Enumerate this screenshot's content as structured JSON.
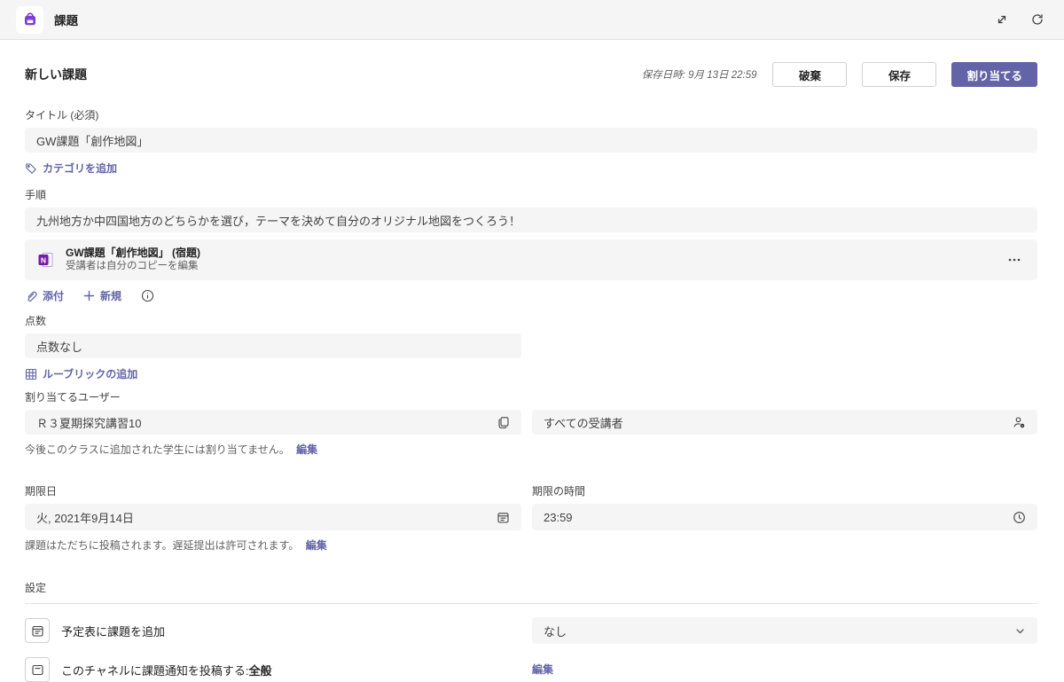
{
  "accent": "#6264a7",
  "topbar": {
    "app_title": "課題"
  },
  "header": {
    "page_title": "新しい課題",
    "saved_at": "保存日時: 9月 13日 22:59",
    "discard_label": "破棄",
    "save_label": "保存",
    "assign_label": "割り当てる"
  },
  "form": {
    "title_label": "タイトル (必須)",
    "title_value": "GW課題「創作地図」",
    "add_category_label": "カテゴリを追加",
    "instructions_label": "手順",
    "instructions_value": "九州地方か中四国地方のどちらかを選び，テーマを決めて自分のオリジナル地図をつくろう！",
    "attachment": {
      "title": "GW課題「創作地図」 (宿題)",
      "subtitle": "受講者は自分のコピーを編集"
    },
    "attach_label": "添付",
    "new_label": "新規",
    "points_label": "点数",
    "points_value": "点数なし",
    "add_rubric_label": "ルーブリックの追加",
    "assign_to_label": "割り当てるユーザー",
    "class_value": "Ｒ３夏期探究講習10",
    "students_value": "すべての受講者",
    "future_note": "今後このクラスに追加された学生には割り当てません。",
    "edit_label": "編集",
    "due_date_label": "期限日",
    "due_date_value": "火, 2021年9月14日",
    "due_time_label": "期限の時間",
    "due_time_value": "23:59",
    "post_note": "課題はただちに投稿されます。遅延提出は許可されます。"
  },
  "settings": {
    "heading": "設定",
    "calendar_row_label": "予定表に課題を追加",
    "calendar_option_value": "なし",
    "channel_row_label": "このチャネルに課題通知を投稿する:",
    "channel_row_value": "全般",
    "edit_label": "編集"
  }
}
